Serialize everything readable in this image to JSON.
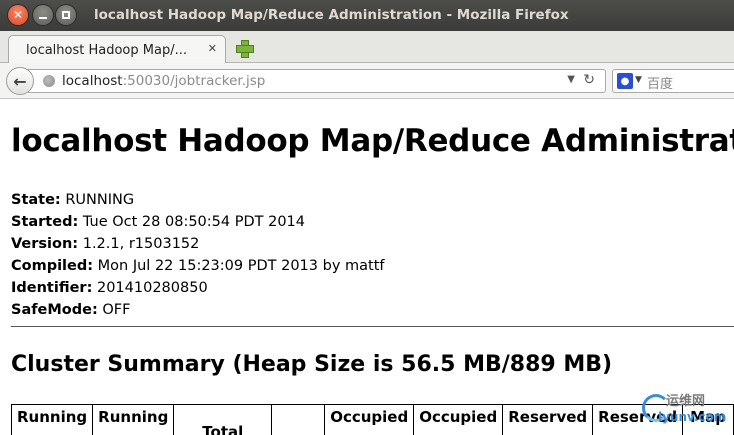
{
  "window": {
    "title": "localhost Hadoop Map/Reduce Administration - Mozilla Firefox"
  },
  "tabs": [
    {
      "label": "localhost Hadoop Map/...",
      "close": "✕"
    }
  ],
  "nav": {
    "url_host": "localhost",
    "url_rest": ":50030/jobtracker.jsp",
    "search_placeholder": "百度"
  },
  "page": {
    "heading": "localhost Hadoop Map/Reduce Administration",
    "info": [
      {
        "label": "State:",
        "value": " RUNNING"
      },
      {
        "label": "Started:",
        "value": " Tue Oct 28 08:50:54 PDT 2014"
      },
      {
        "label": "Version:",
        "value": " 1.2.1, r1503152"
      },
      {
        "label": "Compiled:",
        "value": " Mon Jul 22 15:23:09 PDT 2013 by mattf"
      },
      {
        "label": "Identifier:",
        "value": " 201410280850"
      },
      {
        "label": "SafeMode:",
        "value": " OFF"
      }
    ],
    "cluster_summary_title": "Cluster Summary (Heap Size is 56.5 MB/889 MB)",
    "table_headers": [
      "Running",
      "Running",
      "Total",
      "",
      "Occupied",
      "Occupied",
      "Reserved",
      "Reserved",
      "Map"
    ]
  },
  "watermark": {
    "line1": "运维网",
    "line2": "iyunv.com"
  },
  "colors": {
    "titlebar": "#3f3f3d",
    "close_button": "#e0522b",
    "newtab_plus": "#7bb33c"
  }
}
